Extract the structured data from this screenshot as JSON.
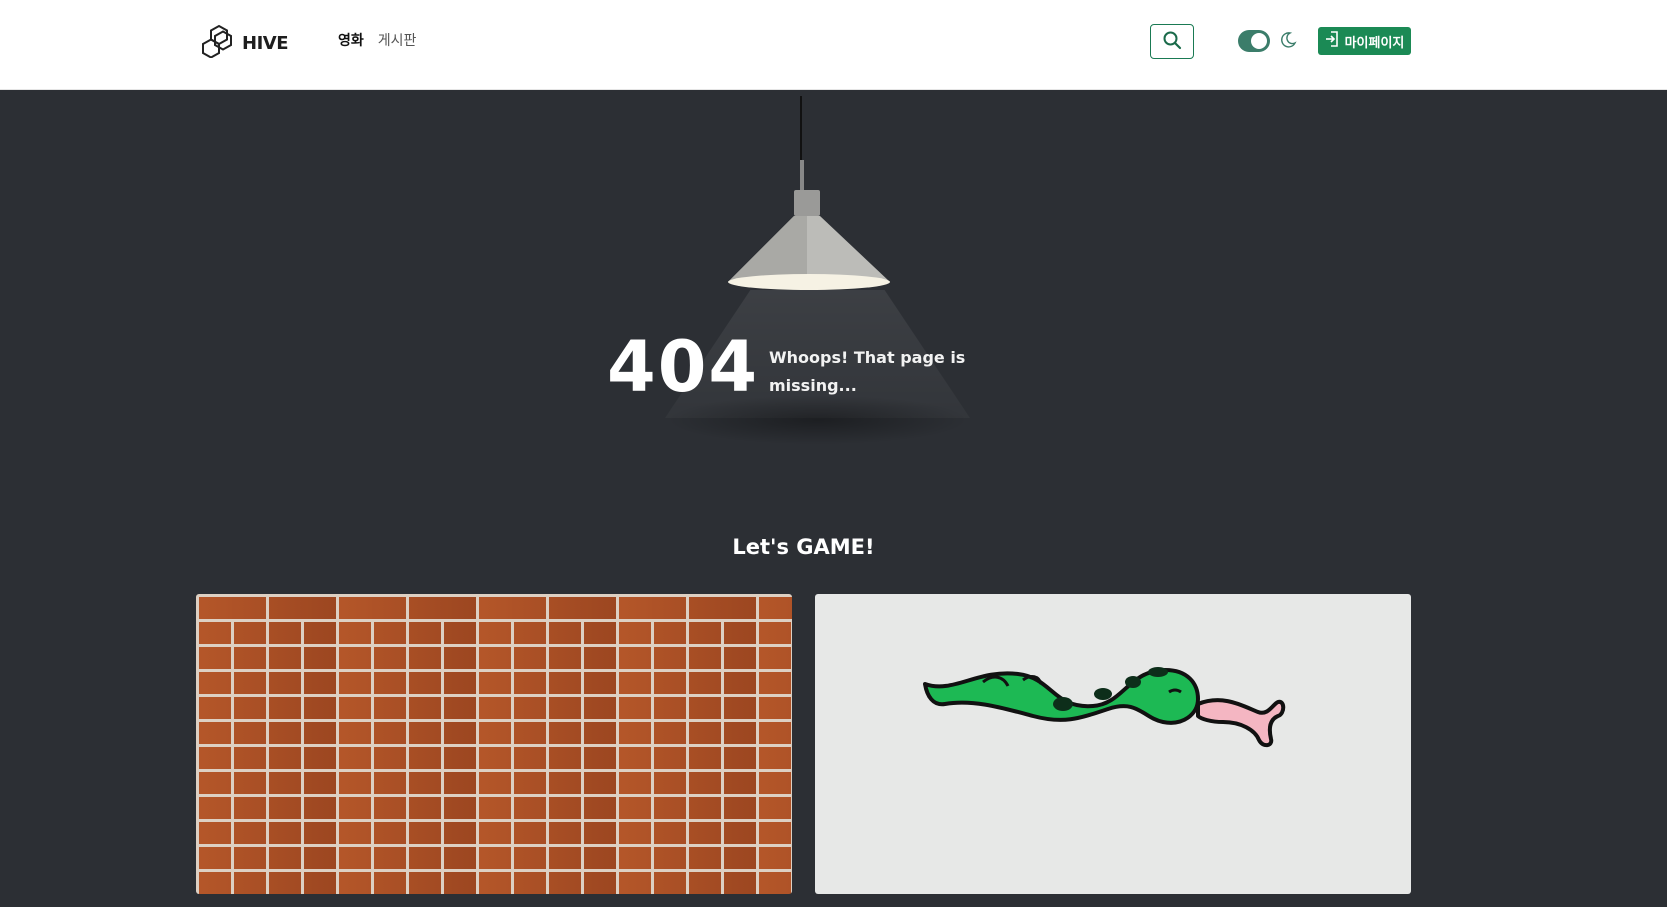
{
  "header": {
    "logo_text": "HIVE",
    "nav": [
      {
        "label": "영화",
        "active": true
      },
      {
        "label": "게시판",
        "active": false
      }
    ],
    "mypage_label": "마이페이지"
  },
  "error": {
    "code": "404",
    "message": "Whoops! That page is missing..."
  },
  "games": {
    "title": "Let's GAME!",
    "cards": [
      {
        "name": "brick-game"
      },
      {
        "name": "snake-game"
      }
    ]
  },
  "colors": {
    "accent": "#1b8a55",
    "toggle": "#3b7d6a",
    "background": "#2c2f34",
    "snake_green": "#1db954",
    "snake_tongue": "#f4b6c2"
  },
  "icons": {
    "logo": "hexagon-logo-icon",
    "search": "search-icon",
    "theme": "moon-icon",
    "login": "login-icon"
  }
}
